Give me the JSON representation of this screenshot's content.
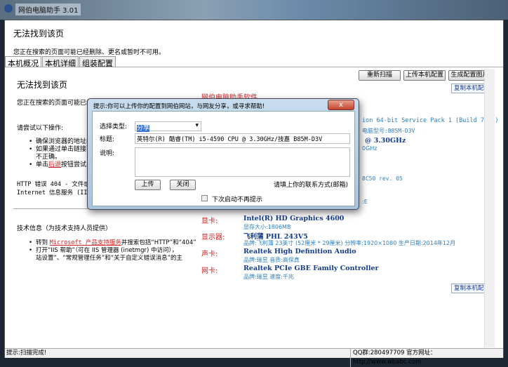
{
  "window": {
    "title": "网伯电脑助手 3.01"
  },
  "header": {
    "title": "无法找到该页",
    "subtitle": "您正在搜索的页面可能已经删除、更名或暂时不可用。"
  },
  "tabs": [
    {
      "label": "本机概况"
    },
    {
      "label": "本机详细"
    },
    {
      "label": "组装配置"
    }
  ],
  "toolbar": {
    "rescan": "重新扫描",
    "upload": "上传本机配置",
    "generate": "生成配置图片",
    "copy": "复制本机配置"
  },
  "error_page": {
    "title": "无法找到该页",
    "desc": "您正在搜索的页面可能已经",
    "try": "请尝试以下操作:",
    "items": [
      "确保浏览器的地址栏",
      "如果通过单击链接而",
      "不正确。",
      "单击",
      "后退",
      "按钮尝试另"
    ],
    "http": "HTTP 错误 404 - 文件或目",
    "iis": "Internet 信息服务 (IIS)",
    "tech": "技术信息（为技术支持人员提供）",
    "t1a": "转到",
    "t1link": "Microsoft 产品支持服务",
    "t1b": "并搜索包括“HTTP”和“404”",
    "t2": "打开“IIS 帮助”（可在 IIS 管理器 (inetmgr) 中访问），",
    "t3": "站设置”、“常规管理任务”和“关于自定义错误消息”的主"
  },
  "info": {
    "brand": "网伯电脑助手软件",
    "os_frag": "ion 64-bit Service Pack 1 (Build 7601)",
    "model_label": "电脑型号",
    "model": ":B85M-D3V",
    "cpu_frag": "@ 3.30GHz",
    "cpu_sub_frag": "0GHz",
    "net_frag": "8C50 rev. 05",
    "disk_frag": ":E",
    "gpu_label": "显卡:",
    "gpu": "Intel(R) HD Graphics 4600",
    "gpu_sub": "显存大小:1806MB",
    "monitor_label": "显示器:",
    "monitor": "飞利蒲 PHL 243V5",
    "monitor_sub": "品牌:飞利蒲 23英寸 (52厘米 * 29厘米) 分辨率:1920×1080 生产日期:2014年12月",
    "audio_label": "声卡:",
    "audio": "Realtek High Definition Audio",
    "audio_sub": "品牌:瑞昱 音质:高保真",
    "nic_label": "网卡:",
    "nic": "Realtek PCIe GBE Family Controller",
    "nic_sub": "品牌:瑞昱 速度:千兆"
  },
  "dialog": {
    "title": "提示:你可以上传你的配置到网伯网站，与网友分享，或寻求帮助!",
    "close": "x",
    "type_label": "选择类型:",
    "type_value": "分享",
    "title_label": "标题:",
    "title_value": "英特尔(R) 酷睿(TM) i5-4590 CPU @ 3.30GHz/技嘉 B85M-D3V",
    "desc_label": "说明:",
    "desc_value": "",
    "upload": "上传",
    "close_btn": "关闭",
    "contact": "请填上你的联系方式(邮箱)",
    "no_show": "下次启动不再提示",
    "no_show_checked": false
  },
  "status": {
    "left": "提示:扫描完成!",
    "right": "QQ群:280497709 官方网址：http://www.wbabc.com"
  }
}
